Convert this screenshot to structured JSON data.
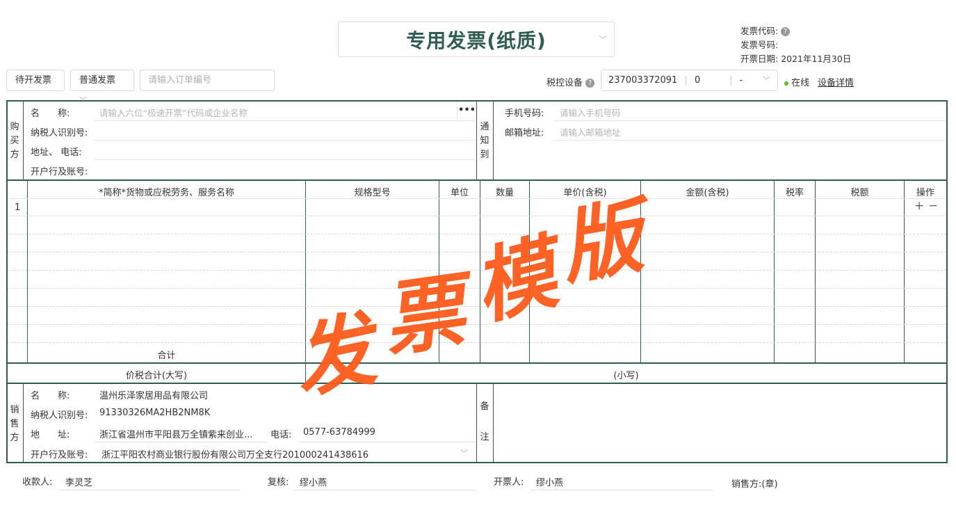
{
  "invoice_title": "专用发票(纸质)",
  "meta": {
    "code_label": "发票代码:",
    "number_label": "发票号码:",
    "date_label": "开票日期:",
    "date_value": "2021年11月30日"
  },
  "toolbar": {
    "pending_button": "待开发票",
    "type_select": "普通发票",
    "order_placeholder": "请输入订单编号",
    "device_label": "税控设备",
    "device_id": "237003372091",
    "device_num": "0",
    "device_dash": "-",
    "online_label": "在线",
    "device_detail": "设备详情"
  },
  "buyer": {
    "side_label": [
      "购",
      "买",
      "方"
    ],
    "name_label": "名　　称:",
    "name_placeholder": "请输入六位“极速开票”代码或企业名称",
    "taxid_label": "纳税人识别号:",
    "address_label": "地址、 电话:",
    "bank_label": "开户行及账号:"
  },
  "notify": {
    "side_label": [
      "通",
      "知",
      "到"
    ],
    "phone_label": "手机号码:",
    "phone_placeholder": "请输入手机号码",
    "email_label": "邮箱地址:",
    "email_placeholder": "请输入邮箱地址"
  },
  "items": {
    "columns": [
      "*简称*货物或应税劳务、服务名称",
      "规格型号",
      "单位",
      "数量",
      "单价(含税)",
      "金额(含税)",
      "税率",
      "税额",
      "操作"
    ],
    "row_number": "1",
    "add": "+",
    "remove": "−",
    "subtotal_label": "合计",
    "total_big_label": "价税合计(大写)",
    "total_small_label": "(小写)"
  },
  "seller": {
    "side_label": [
      "销",
      "售",
      "方"
    ],
    "name_label": "名　　称:",
    "name_value": "温州乐泽家居用品有限公司",
    "taxid_label": "纳税人识别号:",
    "taxid_value": "91330326MA2HB2NM8K",
    "address_label": "地　　址:",
    "address_value": "浙江省温州市平阳县万全镇紫来创业...",
    "phone_label": "电话:",
    "phone_value": "0577-63784999",
    "bank_label": "开户行及账号:",
    "bank_value": "浙江平阳农村商业银行股份有限公司万全支行201000241438616"
  },
  "remarks": {
    "side_label": [
      "备",
      "注"
    ]
  },
  "footer": {
    "payee_label": "收款人:",
    "payee_value": "李灵芝",
    "reviewer_label": "复核:",
    "reviewer_value": "缪小燕",
    "issuer_label": "开票人:",
    "issuer_value": "缪小燕",
    "seller_seal_label": "销售方:(章)"
  },
  "watermark": [
    "发",
    "票",
    "模",
    "版"
  ],
  "colors": {
    "frame": "#2f5d50",
    "stamp": "#ff5a1a",
    "online": "#52c41a"
  }
}
